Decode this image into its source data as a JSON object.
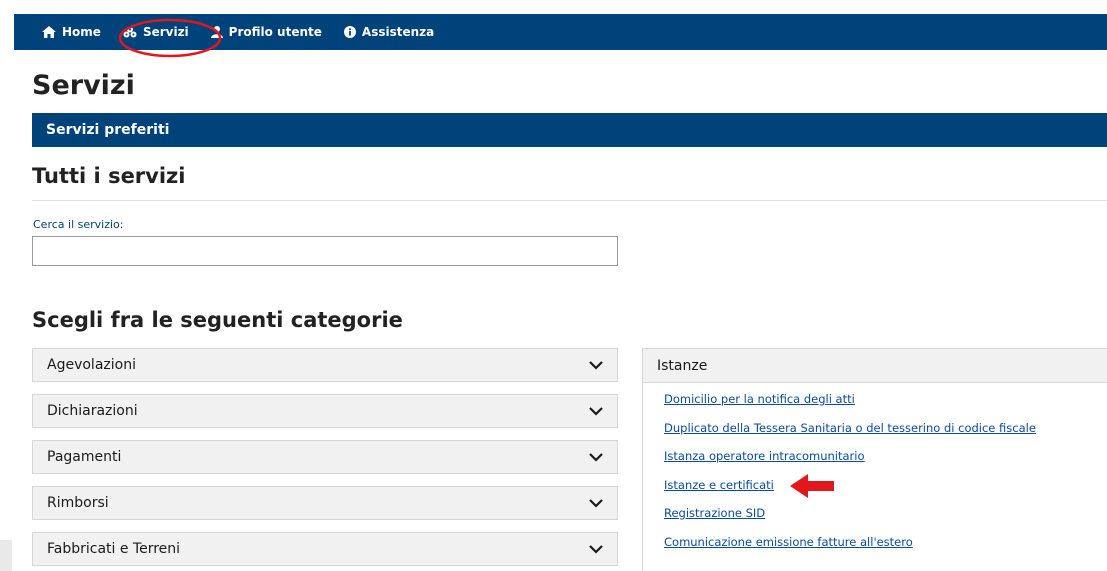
{
  "nav": {
    "items": [
      {
        "label": "Home",
        "icon": "home-icon"
      },
      {
        "label": "Servizi",
        "icon": "services-icon"
      },
      {
        "label": "Profilo utente",
        "icon": "user-icon"
      },
      {
        "label": "Assistenza",
        "icon": "info-icon"
      }
    ]
  },
  "page": {
    "title": "Servizi",
    "favorites_label": "Servizi preferiti",
    "all_services_title": "Tutti i servizi"
  },
  "search": {
    "label": "Cerca il servizio:",
    "value": "",
    "placeholder": ""
  },
  "categories": {
    "title": "Scegli fra le seguenti categorie",
    "items": [
      {
        "label": "Agevolazioni"
      },
      {
        "label": "Dichiarazioni"
      },
      {
        "label": "Pagamenti"
      },
      {
        "label": "Rimborsi"
      },
      {
        "label": "Fabbricati e Terreni"
      }
    ]
  },
  "panel": {
    "title": "Istanze",
    "links": [
      {
        "label": "Domicilio per la notifica degli atti"
      },
      {
        "label": "Duplicato della Tessera Sanitaria o del tesserino di codice fiscale"
      },
      {
        "label": "Istanza operatore intracomunitario"
      },
      {
        "label": "Istanze e certificati"
      },
      {
        "label": "Registrazione SID"
      },
      {
        "label": "Comunicazione emissione fatture all'estero"
      }
    ]
  },
  "colors": {
    "brand_blue": "#00427a",
    "link_blue": "#0a4aa0",
    "annotation_red": "#e3161c"
  }
}
